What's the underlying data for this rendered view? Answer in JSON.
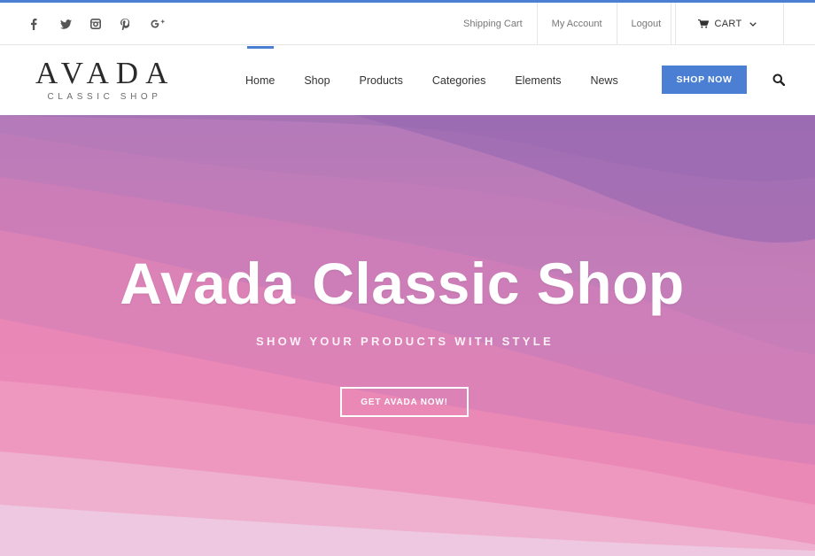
{
  "colors": {
    "accent": "#4a7fd4",
    "hero_top": "#a974b6",
    "hero_bottom": "#f48fb5"
  },
  "topbar": {
    "social_icons": [
      "facebook-icon",
      "twitter-icon",
      "instagram-icon",
      "pinterest-icon",
      "google-plus-icon"
    ],
    "links": {
      "shipping_cart": "Shipping Cart",
      "my_account": "My Account",
      "logout": "Logout"
    },
    "cart_label": "CART"
  },
  "header": {
    "logo_main": "AVADA",
    "logo_sub": "CLASSIC SHOP",
    "nav": [
      "Home",
      "Shop",
      "Products",
      "Categories",
      "Elements",
      "News"
    ],
    "active_nav": "Home",
    "shop_now_label": "SHOP NOW"
  },
  "hero": {
    "title": "Avada Classic Shop",
    "subtitle": "SHOW YOUR PRODUCTS WITH STYLE",
    "button_label": "GET AVADA NOW!"
  }
}
